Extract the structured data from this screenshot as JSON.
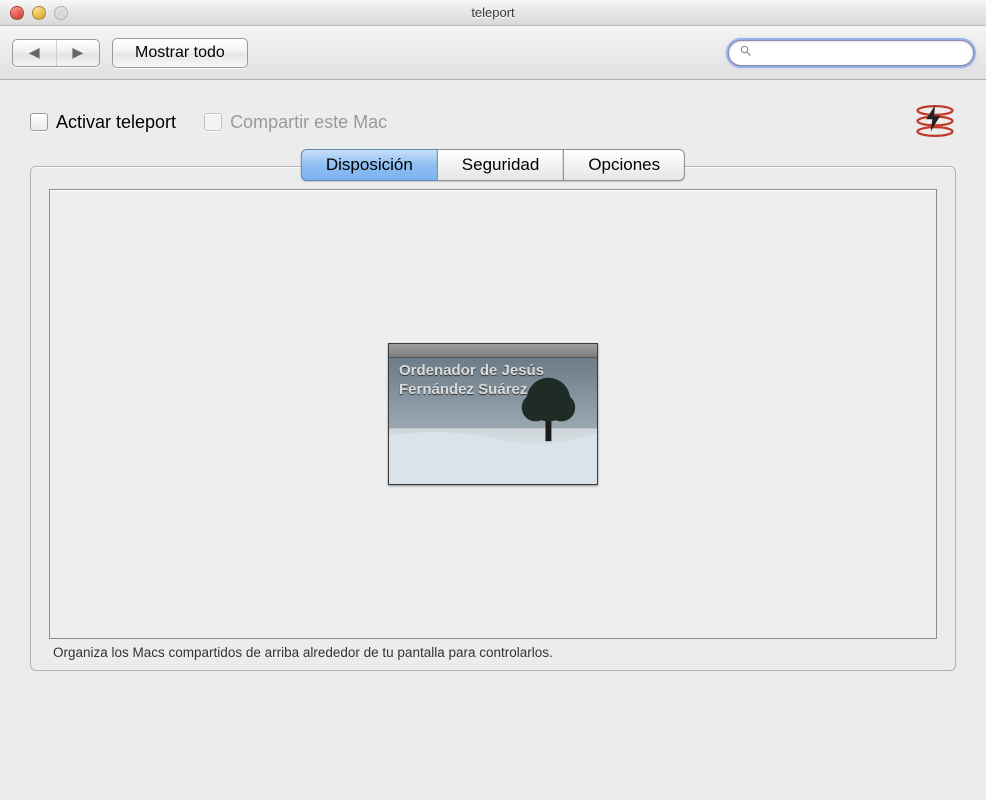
{
  "window": {
    "title": "teleport"
  },
  "toolbar": {
    "show_all_label": "Mostrar todo",
    "search_placeholder": ""
  },
  "options": {
    "activate_label": "Activar teleport",
    "share_label": "Compartir este Mac"
  },
  "tabs": {
    "items": [
      {
        "label": "Disposición",
        "active": true
      },
      {
        "label": "Seguridad",
        "active": false
      },
      {
        "label": "Opciones",
        "active": false
      }
    ]
  },
  "monitor": {
    "name": "Ordenador de Jesús Fernández Suárez"
  },
  "hint": "Organiza los Macs compartidos de arriba alrededor de tu pantalla para controlarlos."
}
